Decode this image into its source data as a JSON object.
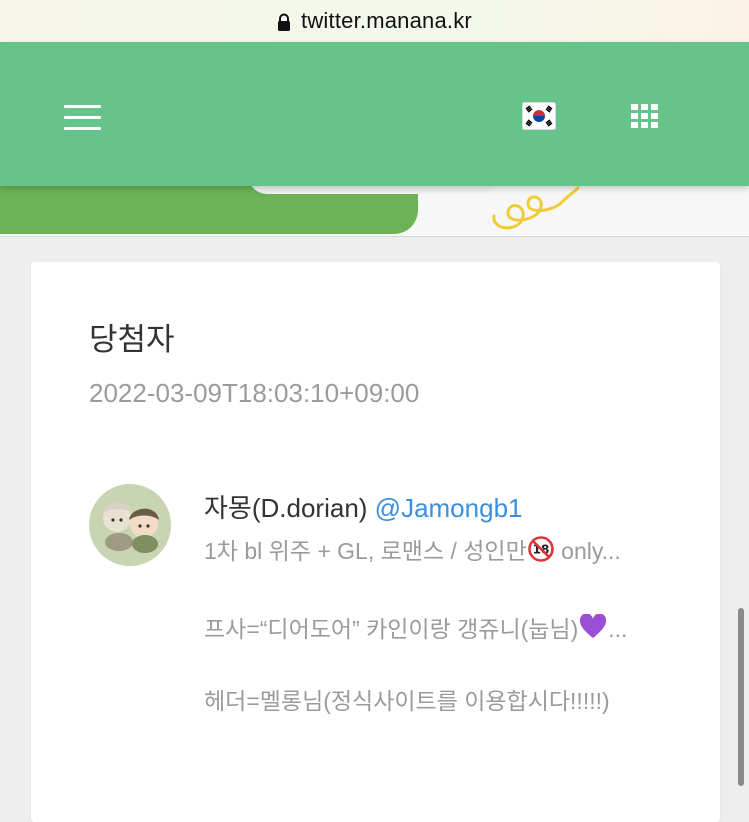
{
  "browser": {
    "url": "twitter.manana.kr"
  },
  "nav": {
    "menu_icon": "hamburger-menu-icon",
    "language_icon": "korean-flag-icon",
    "apps_icon": "grid-apps-icon",
    "background_color": "#66c48a"
  },
  "post": {
    "title": "당첨자",
    "timestamp": "2022-03-09T18:03:10+09:00"
  },
  "user": {
    "name": "자몽(D.dorian)",
    "handle": "@Jamongb1",
    "handle_color": "#3a8fe0",
    "bio": {
      "line1_text": "1차 bl 위주 + GL, 로맨스 / 성인만",
      "line1_emoji": "no-one-under-18-icon",
      "line1_suffix": " only...",
      "line2_text": "프사=“디어도어” 카인이랑 갱쥬니(눕님)",
      "line2_emoji": "purple-heart-icon",
      "line2_suffix": "...",
      "line3_text": "헤더=멜롱님(정식사이트를 이용합시다!!!!!)"
    }
  }
}
